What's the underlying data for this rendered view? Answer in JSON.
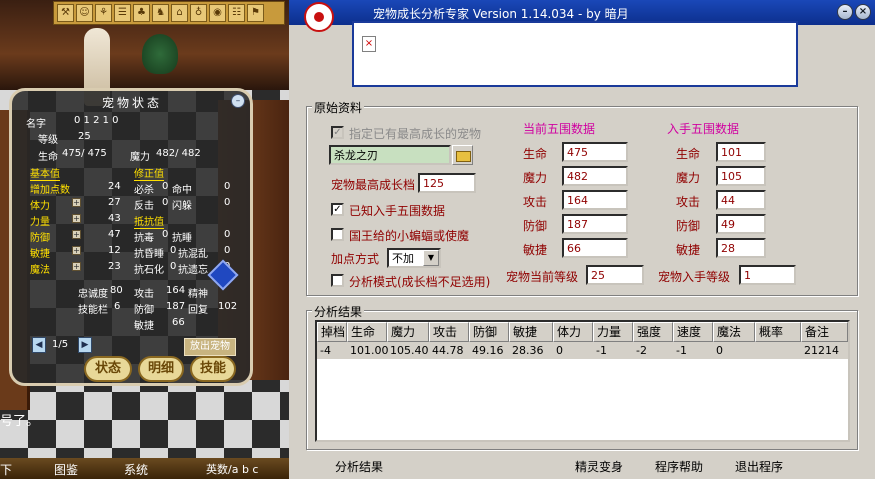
{
  "game": {
    "topbar_icons": [
      "⚒",
      "☺",
      "⚘",
      "☰",
      "♣",
      "♞",
      "⌂",
      "♁",
      "◉",
      "☷",
      "⚑"
    ],
    "floor_text": "号了。",
    "panel": {
      "title": "宠物状态",
      "name_label": "名字",
      "name_value": "0 1 2 1 0",
      "level_label": "等级",
      "level_value": "25",
      "hp_label": "生命",
      "hp_value": "475/ 475",
      "mp_label": "魔力",
      "mp_value": "482/ 482",
      "base_header": "基本值",
      "mod_header": "修正值",
      "resist_header": "抵抗值",
      "base_rows": [
        {
          "label": "增加点数",
          "value": "24"
        },
        {
          "label": "体力",
          "value": "27"
        },
        {
          "label": "力量",
          "value": "43"
        },
        {
          "label": "防御",
          "value": "47"
        },
        {
          "label": "敏捷",
          "value": "12"
        },
        {
          "label": "魔法",
          "value": "23"
        }
      ],
      "mod_rows": [
        {
          "label": "必杀",
          "value": "0",
          "label2": "命中",
          "value2": "0"
        },
        {
          "label": "反击",
          "value": "0",
          "label2": "闪躲",
          "value2": "0"
        }
      ],
      "resist_rows": [
        {
          "label": "抗毒",
          "value": "0",
          "label2": "抗睡",
          "value2": "0"
        },
        {
          "label": "抗昏睡",
          "value": "0",
          "label2": "抗混乱",
          "value2": "0"
        },
        {
          "label": "抗石化",
          "value": "0",
          "label2": "抗遗忘",
          "value2": "0"
        }
      ],
      "extra": [
        {
          "label": "忠诚度",
          "value": "80",
          "label2": "攻击",
          "value2": "164",
          "label3": "精神",
          "value3": ""
        },
        {
          "label": "技能栏",
          "value": "6",
          "label2": "防御",
          "value2": "187",
          "label3": "回复",
          "value3": "102"
        },
        {
          "label": "",
          "value": "",
          "label2": "敏捷",
          "value2": "66",
          "label3": "",
          "value3": ""
        }
      ],
      "page": "1/5",
      "release_button": "放出宠物"
    },
    "oval_buttons": [
      "状态",
      "明细",
      "技能"
    ],
    "bottom_bar": [
      "下",
      "图鉴",
      "系统",
      "英数/a b c"
    ]
  },
  "app": {
    "title": "宠物成长分析专家 Version 1.14.034 - by 暗月",
    "original_group": "原始资料",
    "specify_checkbox": "指定已有最高成长的宠物",
    "pet_name": "杀龙之刃",
    "max_growth_label": "宠物最高成长档",
    "max_growth_value": "125",
    "known_checkbox": "已知入手五围数据",
    "known_checked": true,
    "king_checkbox": "国王给的小蝙蝠或使魔",
    "add_method_label": "加点方式",
    "add_method_value": "不加",
    "analysis_mode_checkbox": "分析模式(成长档不足选用)",
    "current_header": "当前五围数据",
    "initial_header": "入手五围数据",
    "stats": [
      {
        "label": "生命",
        "current": "475",
        "initial": "101"
      },
      {
        "label": "魔力",
        "current": "482",
        "initial": "105"
      },
      {
        "label": "攻击",
        "current": "164",
        "initial": "44"
      },
      {
        "label": "防御",
        "current": "187",
        "initial": "49"
      },
      {
        "label": "敏捷",
        "current": "66",
        "initial": "28"
      }
    ],
    "current_level_label": "宠物当前等级",
    "current_level_value": "25",
    "initial_level_label": "宠物入手等级",
    "initial_level_value": "1",
    "result_group": "分析结果",
    "columns": [
      "掉档",
      "生命",
      "魔力",
      "攻击",
      "防御",
      "敏捷",
      "体力",
      "力量",
      "强度",
      "速度",
      "魔法",
      "概率",
      "备注"
    ],
    "rows": [
      [
        "-4",
        "101.00",
        "105.40",
        "44.78",
        "49.16",
        "28.36",
        "0",
        "-1",
        "-2",
        "-1",
        "0",
        "",
        "21214"
      ]
    ],
    "menu": [
      "分析结果",
      "精灵变身",
      "程序帮助",
      "退出程序"
    ]
  }
}
